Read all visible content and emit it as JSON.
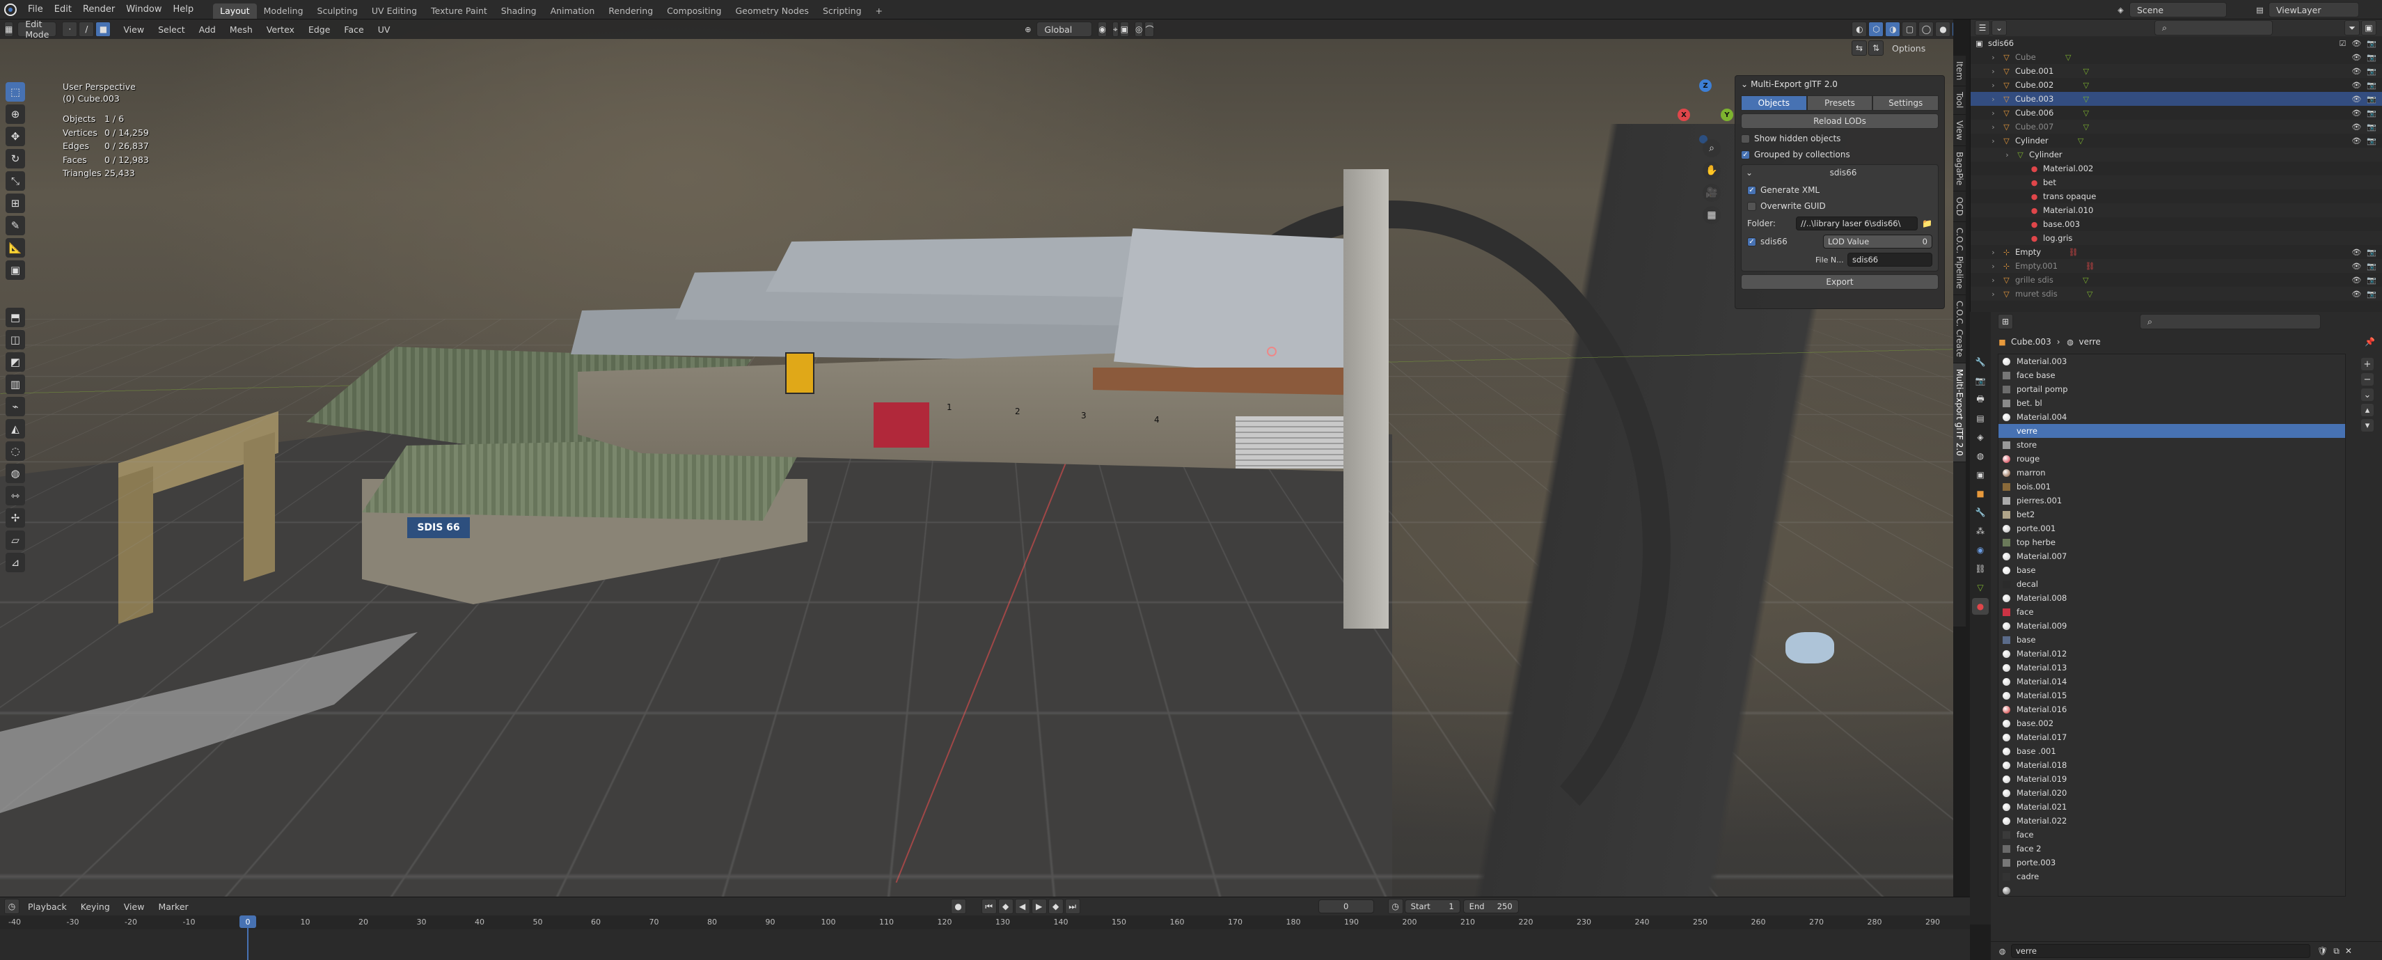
{
  "topbar": {
    "menus": [
      "File",
      "Edit",
      "Render",
      "Window",
      "Help"
    ],
    "workspaces": [
      "Layout",
      "Modeling",
      "Sculpting",
      "UV Editing",
      "Texture Paint",
      "Shading",
      "Animation",
      "Rendering",
      "Compositing",
      "Geometry Nodes",
      "Scripting"
    ],
    "active_workspace": "Layout",
    "add_tab": "+",
    "scene": "Scene",
    "view_layer": "ViewLayer"
  },
  "viewport_header": {
    "mode": "Edit Mode",
    "menus": [
      "View",
      "Select",
      "Add",
      "Mesh",
      "Vertex",
      "Edge",
      "Face",
      "UV"
    ],
    "orientation": "Global",
    "options": "Options"
  },
  "viewport_info": {
    "perspective": "User Perspective",
    "object": "(0) Cube.003"
  },
  "stats": [
    {
      "label": "Objects",
      "value": "1 / 6"
    },
    {
      "label": "Vertices",
      "value": "0 / 14,259"
    },
    {
      "label": "Edges",
      "value": "0 / 26,837"
    },
    {
      "label": "Faces",
      "value": "0 / 12,983"
    },
    {
      "label": "Triangles",
      "value": "25,433"
    }
  ],
  "scene_labels": {
    "sign": "SDIS 66",
    "doors": [
      "1",
      "2",
      "3",
      "4"
    ]
  },
  "gizmo": {
    "x": "X",
    "y": "Y",
    "z": "Z"
  },
  "sidebar_tabs": [
    "Item",
    "Tool",
    "View",
    "BagaPie",
    "OCD",
    "C.O.C. Pipeline",
    "C.O.C. Create",
    "Multi-Export glTF 2.0"
  ],
  "export_panel": {
    "title": "Multi-Export glTF 2.0",
    "tabs": [
      "Objects",
      "Presets",
      "Settings"
    ],
    "active_tab": "Objects",
    "reload": "Reload LODs",
    "show_hidden": "Show hidden objects",
    "grouped": "Grouped by collections",
    "collection": "sdis66",
    "generate_xml": "Generate XML",
    "overwrite_guid": "Overwrite GUID",
    "folder_label": "Folder:",
    "folder_value": "//..\\library laser 6\\sdis66\\",
    "item_name": "sdis66",
    "lod_label": "LOD Value",
    "lod_value": "0",
    "file_label": "File N...",
    "file_value": "sdis66",
    "export": "Export"
  },
  "outliner": {
    "root": "sdis66",
    "rows": [
      {
        "name": "Cube",
        "indent": 1,
        "icon": "mesh",
        "dim": true
      },
      {
        "name": "Cube.001",
        "indent": 1,
        "icon": "mesh"
      },
      {
        "name": "Cube.002",
        "indent": 1,
        "icon": "mesh"
      },
      {
        "name": "Cube.003",
        "indent": 1,
        "icon": "mesh",
        "selected": true
      },
      {
        "name": "Cube.006",
        "indent": 1,
        "icon": "mesh"
      },
      {
        "name": "Cube.007",
        "indent": 1,
        "icon": "mesh",
        "dim": true
      },
      {
        "name": "Cylinder",
        "indent": 1,
        "icon": "mesh"
      },
      {
        "name": "Cylinder",
        "indent": 2,
        "icon": "data"
      },
      {
        "name": "Material.002",
        "indent": 3,
        "icon": "mat"
      },
      {
        "name": "bet",
        "indent": 3,
        "icon": "mat"
      },
      {
        "name": "trans opaque",
        "indent": 3,
        "icon": "mat"
      },
      {
        "name": "Material.010",
        "indent": 3,
        "icon": "mat"
      },
      {
        "name": "base.003",
        "indent": 3,
        "icon": "mat"
      },
      {
        "name": "log.gris",
        "indent": 3,
        "icon": "mat"
      },
      {
        "name": "Empty",
        "indent": 1,
        "icon": "empty"
      },
      {
        "name": "Empty.001",
        "indent": 1,
        "icon": "empty",
        "dim": true
      },
      {
        "name": "grille sdis",
        "indent": 1,
        "icon": "mesh",
        "dim": true
      },
      {
        "name": "muret sdis",
        "indent": 1,
        "icon": "mesh",
        "dim": true
      }
    ]
  },
  "properties": {
    "path_object": "Cube.003",
    "path_material": "verre",
    "materials": [
      {
        "name": "Material.003",
        "kind": "ball",
        "color": "#d0d0d0"
      },
      {
        "name": "face base",
        "kind": "tex",
        "color": "#777"
      },
      {
        "name": "portail pomp",
        "kind": "tex",
        "color": "#6c6c6c"
      },
      {
        "name": "bet. bl",
        "kind": "tex",
        "color": "#8a8a8a"
      },
      {
        "name": "Material.004",
        "kind": "ball",
        "color": "#d0d0d0"
      },
      {
        "name": "verre",
        "kind": "tex",
        "color": "#4772b3",
        "selected": true
      },
      {
        "name": "store",
        "kind": "tex",
        "color": "#999"
      },
      {
        "name": "rouge",
        "kind": "ball",
        "color": "#c23"
      },
      {
        "name": "marron",
        "kind": "ball",
        "color": "#7a4a2a"
      },
      {
        "name": "bois.001",
        "kind": "tex",
        "color": "#8a6a3a"
      },
      {
        "name": "pierres.001",
        "kind": "tex",
        "color": "#aaa"
      },
      {
        "name": "bet2",
        "kind": "tex",
        "color": "#b0a48a"
      },
      {
        "name": "porte.001",
        "kind": "ball",
        "color": "#bbb"
      },
      {
        "name": "top herbe",
        "kind": "tex",
        "color": "#6b7a5a"
      },
      {
        "name": "Material.007",
        "kind": "ball",
        "color": "#ccc"
      },
      {
        "name": "base",
        "kind": "ball",
        "color": "#ddd"
      },
      {
        "name": "decal",
        "kind": "tex",
        "color": "#2b2b2b"
      },
      {
        "name": "Material.008",
        "kind": "ball",
        "color": "#ccc"
      },
      {
        "name": "face",
        "kind": "tex",
        "color": "#c34"
      },
      {
        "name": "Material.009",
        "kind": "ball",
        "color": "#ccc"
      },
      {
        "name": "base",
        "kind": "tex",
        "color": "#5a6b8a"
      },
      {
        "name": "Material.012",
        "kind": "ball",
        "color": "#ccc"
      },
      {
        "name": "Material.013",
        "kind": "ball",
        "color": "#ccc"
      },
      {
        "name": "Material.014",
        "kind": "ball",
        "color": "#ccc"
      },
      {
        "name": "Material.015",
        "kind": "ball",
        "color": "#ccc"
      },
      {
        "name": "Material.016",
        "kind": "ball",
        "color": "#c22"
      },
      {
        "name": "base.002",
        "kind": "ball",
        "color": "#ccc"
      },
      {
        "name": "Material.017",
        "kind": "ball",
        "color": "#ccc"
      },
      {
        "name": "base .001",
        "kind": "ball",
        "color": "#ccc"
      },
      {
        "name": "Material.018",
        "kind": "ball",
        "color": "#ccc"
      },
      {
        "name": "Material.019",
        "kind": "ball",
        "color": "#ccc"
      },
      {
        "name": "Material.020",
        "kind": "ball",
        "color": "#ccc"
      },
      {
        "name": "Material.021",
        "kind": "ball",
        "color": "#ccc"
      },
      {
        "name": "Material.022",
        "kind": "ball",
        "color": "#ccc"
      },
      {
        "name": "face",
        "kind": "tex",
        "color": "#3a3a3a"
      },
      {
        "name": "face 2",
        "kind": "tex",
        "color": "#6a6a6a"
      },
      {
        "name": "porte.003",
        "kind": "tex",
        "color": "#777"
      },
      {
        "name": "cadre",
        "kind": "tex",
        "color": "#333"
      }
    ],
    "bottom_material": "verre"
  },
  "timeline": {
    "menus": [
      "Playback",
      "Keying",
      "View",
      "Marker"
    ],
    "current_frame": "0",
    "start_label": "Start",
    "start": "1",
    "end_label": "End",
    "end": "250",
    "playhead": "0",
    "ticks": [
      "-40",
      "-30",
      "-20",
      "-10",
      "10",
      "20",
      "30",
      "40",
      "50",
      "60",
      "70",
      "80",
      "90",
      "100",
      "110",
      "120",
      "130",
      "140",
      "150",
      "160",
      "170",
      "180",
      "190",
      "200",
      "210",
      "220",
      "230",
      "240",
      "250",
      "260",
      "270",
      "280",
      "290"
    ]
  },
  "colors": {
    "accent": "#4772b3",
    "selected_row": "#334d80",
    "axis_x": "#e0464a",
    "axis_y": "#7db32f",
    "axis_z": "#3d7fd6"
  }
}
